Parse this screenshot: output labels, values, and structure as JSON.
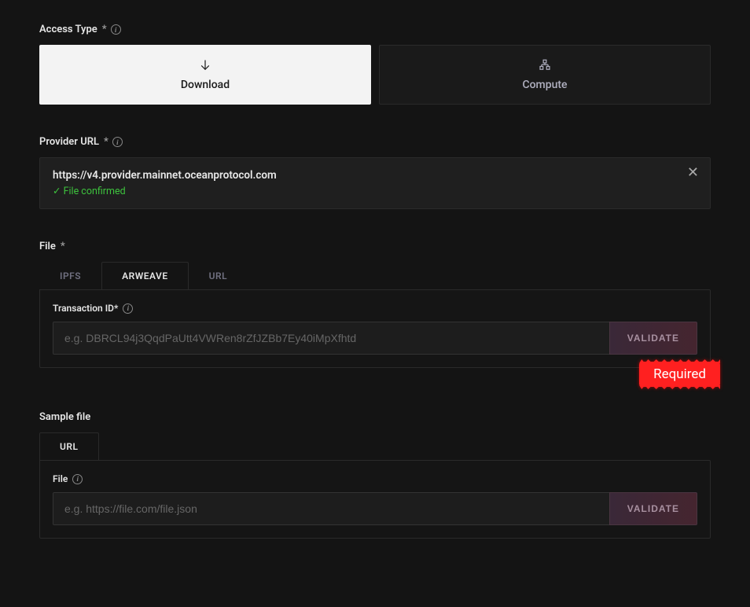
{
  "access_type": {
    "label": "Access Type",
    "required_mark": "*",
    "options": {
      "download": "Download",
      "compute": "Compute"
    }
  },
  "provider": {
    "label": "Provider URL",
    "required_mark": "*",
    "url": "https://v4.provider.mainnet.oceanprotocol.com",
    "status": "✓ File confirmed",
    "close": "✕"
  },
  "file": {
    "label": "File",
    "required_mark": "*",
    "tabs": {
      "ipfs": "IPFS",
      "arweave": "ARWEAVE",
      "url": "URL"
    },
    "transaction_label": "Transaction ID*",
    "transaction_placeholder": "e.g. DBRCL94j3QqdPaUtt4VWRen8rZfJZBb7Ey40iMpXfhtd",
    "validate": "VALIDATE",
    "required_badge": "Required"
  },
  "sample": {
    "label": "Sample file",
    "tabs": {
      "url": "URL"
    },
    "file_label": "File",
    "file_placeholder": "e.g. https://file.com/file.json",
    "validate": "VALIDATE"
  }
}
